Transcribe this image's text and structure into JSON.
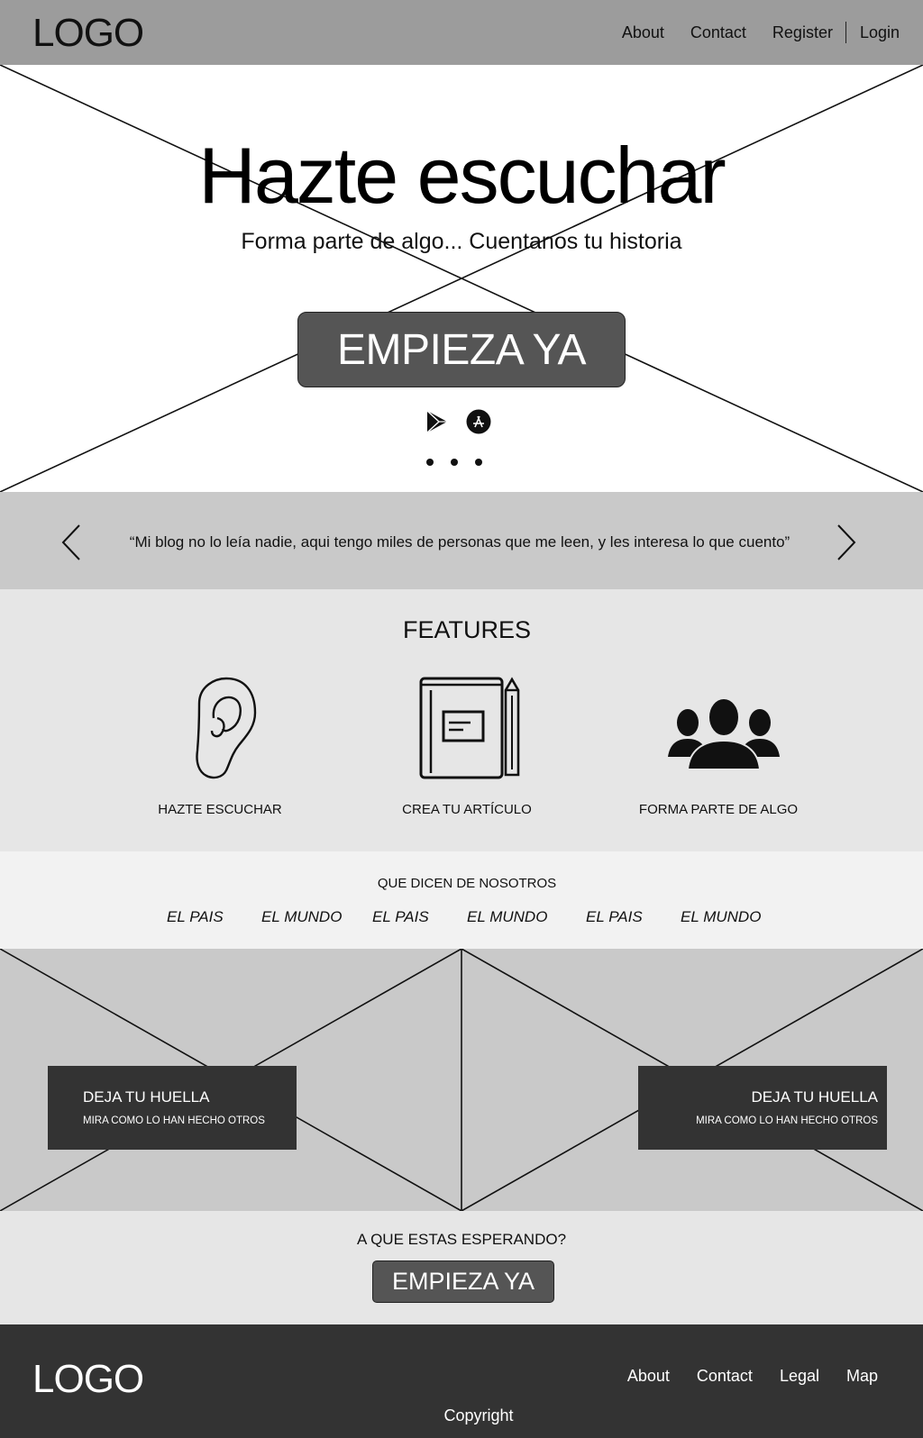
{
  "header": {
    "logo": "LOGO",
    "nav": [
      "About",
      "Contact",
      "Register",
      "Login"
    ]
  },
  "hero": {
    "title": "Hazte escuchar",
    "subtitle": "Forma parte de algo... Cuentanos tu historia",
    "cta": "EMPIEZA YA",
    "store_icons": [
      "google-play-icon",
      "app-store-icon"
    ],
    "carousel_dots": 3
  },
  "testimonial": {
    "quote": "“Mi blog no lo leía nadie, aqui tengo miles de personas que me leen, y les interesa lo que cuento”"
  },
  "features": {
    "title": "FEATURES",
    "items": [
      {
        "label": "HAZTE ESCUCHAR",
        "icon": "ear-icon"
      },
      {
        "label": "CREA TU ARTÍCULO",
        "icon": "notebook-pencil-icon"
      },
      {
        "label": "FORMA PARTE DE ALGO",
        "icon": "group-people-icon"
      }
    ]
  },
  "press": {
    "title": "QUE DICEN DE NOSOTROS",
    "items": [
      "EL PAIS",
      "EL MUNDO",
      "EL PAIS",
      "EL MUNDO",
      "EL PAIS",
      "EL MUNDO"
    ]
  },
  "band": {
    "left": {
      "title": "DEJA TU HUELLA",
      "subtitle": "MIRA COMO LO HAN HECHO OTROS"
    },
    "right": {
      "title": "DEJA TU HUELLA",
      "subtitle": "MIRA COMO LO HAN HECHO OTROS"
    }
  },
  "cta_section": {
    "question": "A QUE ESTAS ESPERANDO?",
    "cta": "EMPIEZA YA"
  },
  "footer": {
    "logo": "LOGO",
    "nav": [
      "About",
      "Contact",
      "Legal",
      "Map"
    ],
    "copyright": "Copyright"
  },
  "colors": {
    "header_bg": "#9c9c9c",
    "button_bg": "#555555",
    "dark_bg": "#333333",
    "light_bg": "#e6e6e6",
    "mid_bg": "#c9c9c9"
  }
}
